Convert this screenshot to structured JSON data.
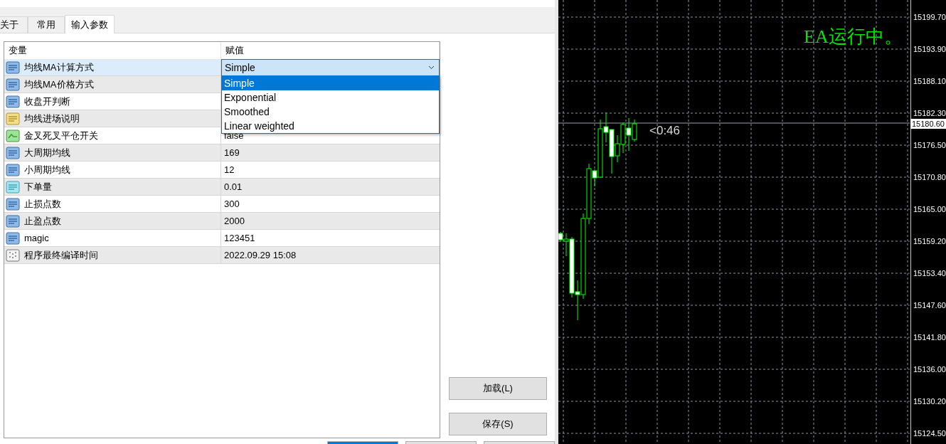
{
  "tabs": [
    {
      "label": "关于",
      "selected": false
    },
    {
      "label": "常用",
      "selected": false
    },
    {
      "label": "输入参数",
      "selected": true
    }
  ],
  "table": {
    "columns": [
      "变量",
      "赋值"
    ],
    "rows": [
      {
        "kind": "int",
        "name": "均线MA计算方式",
        "value": "Simple",
        "selected": true,
        "options": [
          {
            "label": "Simple",
            "selected": true
          },
          {
            "label": "Exponential",
            "selected": false
          },
          {
            "label": "Smoothed",
            "selected": false
          },
          {
            "label": "Linear weighted",
            "selected": false
          }
        ]
      },
      {
        "kind": "int",
        "name": "均线MA价格方式",
        "selected": false
      },
      {
        "kind": "int",
        "name": "收盘开判断",
        "selected": false
      },
      {
        "kind": "string",
        "name": "均线进场说明",
        "selected": false
      },
      {
        "kind": "bool",
        "name": "金叉死叉平仓开关",
        "value": "false",
        "selected": false
      },
      {
        "kind": "int",
        "name": "大周期均线",
        "value": "169",
        "selected": false
      },
      {
        "kind": "int",
        "name": "小周期均线",
        "value": "12",
        "selected": false
      },
      {
        "kind": "double",
        "name": "下单量",
        "value": "0.01",
        "selected": false
      },
      {
        "kind": "int",
        "name": "止损点数",
        "value": "300",
        "selected": false
      },
      {
        "kind": "int",
        "name": "止盈点数",
        "value": "2000",
        "selected": false
      },
      {
        "kind": "int",
        "name": "magic",
        "value": "123451",
        "selected": false
      },
      {
        "kind": "datetime",
        "name": "程序最终编译时间",
        "value": "2022.09.29 15:08",
        "selected": false
      }
    ]
  },
  "buttons": [
    "加载(L)",
    "保存(S)"
  ],
  "footer_buttons": [
    {
      "default": true
    },
    {
      "default": false
    },
    {
      "default": false
    }
  ],
  "chart": {
    "status_text": "EA运行中。",
    "countdown": "<0:46",
    "current_price": "15180.60",
    "price_labels": [
      "15199.70",
      "15193.90",
      "15188.10",
      "15182.30",
      "15176.50",
      "15170.80",
      "15165.00",
      "15159.20",
      "15153.40",
      "15147.60",
      "15141.80",
      "15136.00",
      "15130.20",
      "15124.50"
    ]
  }
}
